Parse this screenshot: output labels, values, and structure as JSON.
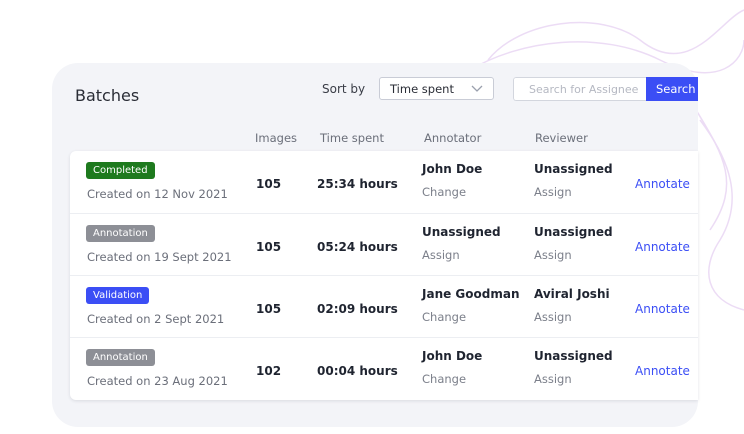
{
  "header": {
    "title": "Batches",
    "sort_label": "Sort by",
    "sort_value": "Time spent",
    "search_placeholder": "Search for Assignee",
    "search_button": "Search"
  },
  "columns": {
    "images": "Images",
    "time_spent": "Time spent",
    "annotator": "Annotator",
    "reviewer": "Reviewer"
  },
  "rows": [
    {
      "status": "Completed",
      "status_color": "#1e7a1e",
      "created": "Created on 12 Nov 2021",
      "images": "105",
      "time": "25:34 hours",
      "annotator": "John Doe",
      "annotator_action": "Change",
      "reviewer": "Unassigned",
      "reviewer_action": "Assign",
      "action": "Annotate"
    },
    {
      "status": "Annotation",
      "status_color": "#8d8f96",
      "created": "Created on 19 Sept 2021",
      "images": "105",
      "time": "05:24 hours",
      "annotator": "Unassigned",
      "annotator_action": "Assign",
      "reviewer": "Unassigned",
      "reviewer_action": "Assign",
      "action": "Annotate"
    },
    {
      "status": "Validation",
      "status_color": "#3b4ef5",
      "created": "Created on 2 Sept 2021",
      "images": "105",
      "time": "02:09 hours",
      "annotator": "Jane Goodman",
      "annotator_action": "Change",
      "reviewer": "Aviral Joshi",
      "reviewer_action": "Assign",
      "action": "Annotate"
    },
    {
      "status": "Annotation",
      "status_color": "#8d8f96",
      "created": "Created on 23 Aug 2021",
      "images": "102",
      "time": "00:04 hours",
      "annotator": "John Doe",
      "annotator_action": "Change",
      "reviewer": "Unassigned",
      "reviewer_action": "Assign",
      "action": "Annotate"
    }
  ],
  "colors": {
    "accent": "#3b4ef5",
    "panel_bg": "#f3f4f8",
    "decor_line": "#ecdcf5"
  }
}
